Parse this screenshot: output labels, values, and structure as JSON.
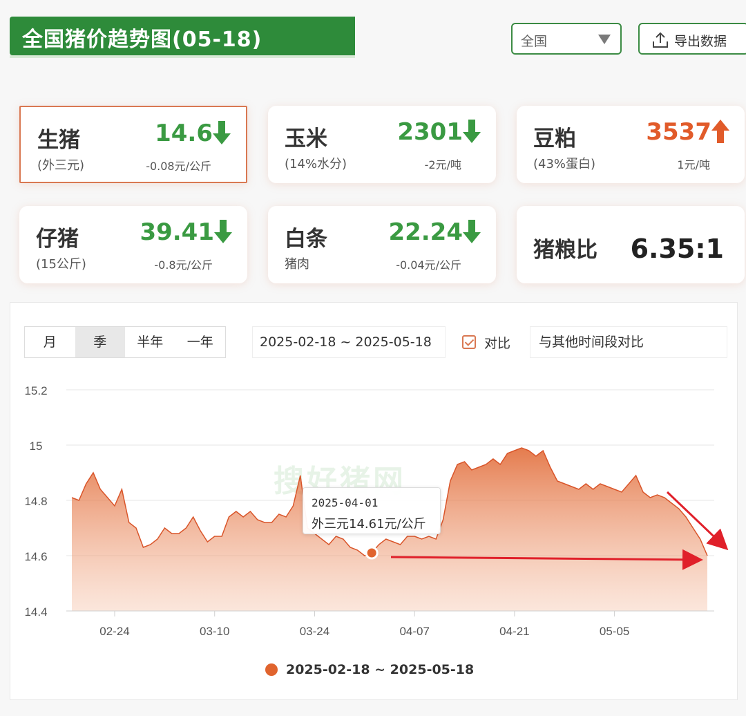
{
  "header": {
    "title": "全国猪价趋势图(05-18)",
    "region": "全国",
    "export_label": "导出数据"
  },
  "cards": [
    {
      "name": "生猪",
      "sub": "(外三元)",
      "value": "14.6",
      "change": "-0.08元/公斤",
      "trend": "down"
    },
    {
      "name": "玉米",
      "sub": "(14%水分)",
      "value": "2301",
      "change": "-2元/吨",
      "trend": "down"
    },
    {
      "name": "豆粕",
      "sub": "(43%蛋白)",
      "value": "3537",
      "change": "1元/吨",
      "trend": "up"
    },
    {
      "name": "仔猪",
      "sub": "(15公斤)",
      "value": "39.41",
      "change": "-0.8元/公斤",
      "trend": "down"
    },
    {
      "name": "白条",
      "sub": "猪肉",
      "value": "22.24",
      "change": "-0.04元/公斤",
      "trend": "down"
    },
    {
      "name": "猪粮比",
      "value": "6.35:1"
    }
  ],
  "controls": {
    "periods": [
      "月",
      "季",
      "半年",
      "一年"
    ],
    "selected_period": "季",
    "date_range": "2025-02-18 ~ 2025-05-18",
    "compare_label": "对比",
    "compare_placeholder": "与其他时间段对比"
  },
  "tooltip": {
    "date": "2025-04-01",
    "value": "外三元14.61元/公斤"
  },
  "watermark": "搜好猪网",
  "legend": "2025-02-18 ~ 2025-05-18",
  "colors": {
    "brand_green": "#2e8b3a",
    "down_green": "#3a9a42",
    "up_orange": "#e15b2a",
    "series": "#e0642e",
    "annotation_red": "#e0202a"
  },
  "icons": {
    "export": "upload-icon",
    "select": "triangle-down-icon",
    "down": "arrow-down-icon",
    "up": "arrow-up-icon"
  },
  "chart_data": {
    "type": "area",
    "title": "",
    "xlabel": "",
    "ylabel": "",
    "ylim": [
      14.4,
      15.2
    ],
    "yticks": [
      14.4,
      14.6,
      14.8,
      15,
      15.2
    ],
    "ytick_labels": [
      "14.4",
      "14.6",
      "14.8",
      "15",
      "15.2"
    ],
    "xticks": [
      "02-24",
      "03-10",
      "03-24",
      "04-07",
      "04-21",
      "05-05"
    ],
    "grid": true,
    "legend": "bottom",
    "series": [
      {
        "name": "2025-02-18 ~ 2025-05-18",
        "x": [
          "2025-02-18",
          "2025-02-19",
          "2025-02-20",
          "2025-02-21",
          "2025-02-22",
          "2025-02-23",
          "2025-02-24",
          "2025-02-25",
          "2025-02-26",
          "2025-02-27",
          "2025-02-28",
          "2025-03-01",
          "2025-03-02",
          "2025-03-03",
          "2025-03-04",
          "2025-03-05",
          "2025-03-06",
          "2025-03-07",
          "2025-03-08",
          "2025-03-09",
          "2025-03-10",
          "2025-03-11",
          "2025-03-12",
          "2025-03-13",
          "2025-03-14",
          "2025-03-15",
          "2025-03-16",
          "2025-03-17",
          "2025-03-18",
          "2025-03-19",
          "2025-03-20",
          "2025-03-21",
          "2025-03-22",
          "2025-03-23",
          "2025-03-24",
          "2025-03-25",
          "2025-03-26",
          "2025-03-27",
          "2025-03-28",
          "2025-03-29",
          "2025-03-30",
          "2025-03-31",
          "2025-04-01",
          "2025-04-02",
          "2025-04-03",
          "2025-04-04",
          "2025-04-05",
          "2025-04-06",
          "2025-04-07",
          "2025-04-08",
          "2025-04-09",
          "2025-04-10",
          "2025-04-11",
          "2025-04-12",
          "2025-04-13",
          "2025-04-14",
          "2025-04-15",
          "2025-04-16",
          "2025-04-17",
          "2025-04-18",
          "2025-04-19",
          "2025-04-20",
          "2025-04-21",
          "2025-04-22",
          "2025-04-23",
          "2025-04-24",
          "2025-04-25",
          "2025-04-26",
          "2025-04-27",
          "2025-04-28",
          "2025-04-29",
          "2025-04-30",
          "2025-05-01",
          "2025-05-02",
          "2025-05-03",
          "2025-05-04",
          "2025-05-05",
          "2025-05-06",
          "2025-05-07",
          "2025-05-08",
          "2025-05-09",
          "2025-05-10",
          "2025-05-11",
          "2025-05-12",
          "2025-05-13",
          "2025-05-14",
          "2025-05-15",
          "2025-05-16",
          "2025-05-17",
          "2025-05-18"
        ],
        "values": [
          14.81,
          14.8,
          14.86,
          14.9,
          14.84,
          14.81,
          14.78,
          14.84,
          14.72,
          14.7,
          14.63,
          14.64,
          14.66,
          14.7,
          14.68,
          14.68,
          14.7,
          14.74,
          14.69,
          14.65,
          14.67,
          14.67,
          14.74,
          14.76,
          14.74,
          14.76,
          14.73,
          14.72,
          14.72,
          14.75,
          14.74,
          14.78,
          14.89,
          14.7,
          14.68,
          14.66,
          14.64,
          14.67,
          14.66,
          14.63,
          14.62,
          14.6,
          14.61,
          14.64,
          14.66,
          14.65,
          14.64,
          14.67,
          14.67,
          14.66,
          14.67,
          14.66,
          14.73,
          14.87,
          14.93,
          14.94,
          14.91,
          14.92,
          14.93,
          14.95,
          14.93,
          14.97,
          14.98,
          14.99,
          14.98,
          14.96,
          14.98,
          14.92,
          14.87,
          14.86,
          14.85,
          14.84,
          14.86,
          14.84,
          14.86,
          14.85,
          14.84,
          14.83,
          14.86,
          14.89,
          14.83,
          14.81,
          14.82,
          14.81,
          14.79,
          14.77,
          14.74,
          14.7,
          14.66,
          14.6
        ]
      }
    ]
  }
}
